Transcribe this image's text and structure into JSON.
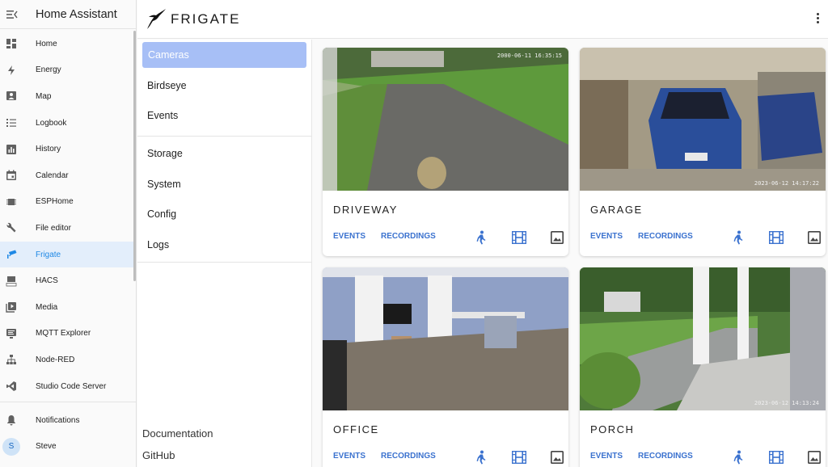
{
  "ha": {
    "title": "Home Assistant",
    "nav": [
      {
        "label": "Home",
        "icon": "dashboard-icon"
      },
      {
        "label": "Energy",
        "icon": "lightning-icon"
      },
      {
        "label": "Map",
        "icon": "map-person-icon"
      },
      {
        "label": "Logbook",
        "icon": "list-icon"
      },
      {
        "label": "History",
        "icon": "chart-box-icon"
      },
      {
        "label": "Calendar",
        "icon": "calendar-icon"
      },
      {
        "label": "ESPHome",
        "icon": "chip-icon"
      },
      {
        "label": "File editor",
        "icon": "wrench-icon"
      },
      {
        "label": "Frigate",
        "icon": "cctv-icon",
        "active": true
      },
      {
        "label": "HACS",
        "icon": "hacs-icon"
      },
      {
        "label": "Media",
        "icon": "play-box-icon"
      },
      {
        "label": "MQTT Explorer",
        "icon": "monitor-icon"
      },
      {
        "label": "Node-RED",
        "icon": "sitemap-icon"
      },
      {
        "label": "Studio Code Server",
        "icon": "vscode-icon"
      }
    ],
    "notifications": "Notifications",
    "user": {
      "name": "Steve",
      "initial": "S"
    }
  },
  "frigate": {
    "brand": "FRIGATE",
    "nav_group1": [
      "Cameras",
      "Birdseye",
      "Events"
    ],
    "nav_group2": [
      "Storage",
      "System",
      "Config",
      "Logs"
    ],
    "footer": [
      "Documentation",
      "GitHub"
    ]
  },
  "cameras": [
    {
      "name": "DRIVEWAY",
      "timestamp": "2000-06-11 16:35:15",
      "events": "EVENTS",
      "recordings": "RECORDINGS"
    },
    {
      "name": "GARAGE",
      "timestamp": "2023-06-12 14:17:22",
      "events": "EVENTS",
      "recordings": "RECORDINGS"
    },
    {
      "name": "OFFICE",
      "timestamp": "",
      "events": "EVENTS",
      "recordings": "RECORDINGS"
    },
    {
      "name": "PORCH",
      "timestamp": "2023-06-12 14:13:24",
      "events": "EVENTS",
      "recordings": "RECORDINGS"
    }
  ],
  "colors": {
    "accent": "#3b72cf",
    "active_nav": "#a7bff6",
    "ha_active": "#1e88e5"
  }
}
